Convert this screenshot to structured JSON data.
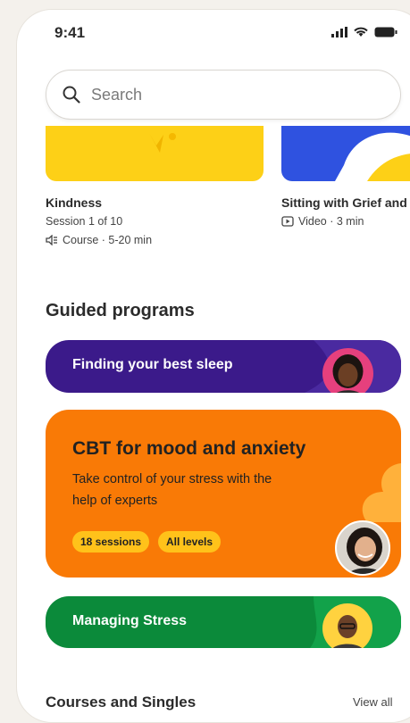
{
  "status": {
    "time": "9:41"
  },
  "search": {
    "placeholder": "Search"
  },
  "cards": [
    {
      "title": "Kindness",
      "subtitle": "Session 1 of 10",
      "meta": "Course · 5-20 min"
    },
    {
      "title": "Sitting with Grief and",
      "meta": "Video · 3 min"
    }
  ],
  "guided": {
    "heading": "Guided programs",
    "sleep": "Finding your best sleep",
    "cbt": {
      "title": "CBT for mood and anxiety",
      "description": "Take control of your stress with the help of experts",
      "tags": [
        "18 sessions",
        "All levels"
      ]
    },
    "stress": "Managing Stress"
  },
  "courses": {
    "heading": "Courses and Singles",
    "view_all": "View all"
  },
  "colors": {
    "sleep": "#3b1a8a",
    "cbt": "#f97a06",
    "stress": "#0b8a3a",
    "tag": "#ffc21a"
  }
}
